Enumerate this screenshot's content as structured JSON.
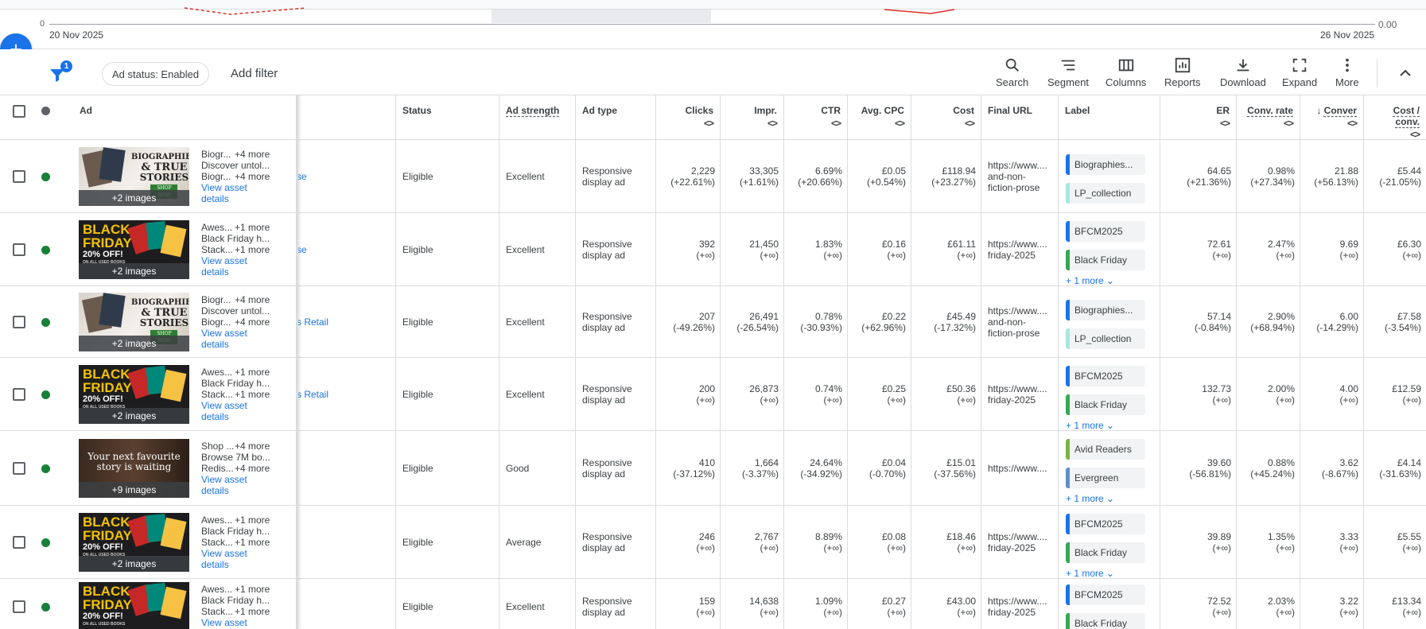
{
  "chart": {
    "axis_left": "0",
    "axis_right": "0.00",
    "date_start": "20 Nov 2025",
    "date_end": "26 Nov 2025"
  },
  "toolbar": {
    "filter_count": "1",
    "status_chip": "Ad status: Enabled",
    "add_filter": "Add filter",
    "tools": [
      "Search",
      "Segment",
      "Columns",
      "Reports",
      "Download",
      "Expand",
      "More"
    ]
  },
  "table": {
    "headers": {
      "ad": "Ad",
      "status": "Status",
      "ad_strength": "Ad strength",
      "ad_type": "Ad type",
      "clicks": "Clicks",
      "impr": "Impr.",
      "ctr": "CTR",
      "avg_cpc": "Avg. CPC",
      "cost": "Cost",
      "final_url": "Final URL",
      "label": "Label",
      "er": "ER",
      "conv_rate": "Conv. rate",
      "conversions": "Conver",
      "cost_conv": "Cost / conv."
    },
    "sort_glyph": "<>",
    "rows": [
      {
        "thumb": "books",
        "images": "+2 images",
        "l1": "Biogr...",
        "l1m": "+4 more",
        "l2": "Discover untol...",
        "l3": "Biogr...",
        "l3m": "+4 more",
        "link1": "View asset",
        "link2": "details",
        "frag": "se",
        "status": "Eligible",
        "strength": "Excellent",
        "type1": "Responsive",
        "type2": "display ad",
        "clicks": "2,229",
        "clicks_c": "(+22.61%)",
        "impr": "33,305",
        "impr_c": "(+1.61%)",
        "ctr": "6.69%",
        "ctr_c": "(+20.66%)",
        "cpc": "£0.05",
        "cpc_c": "(+0.54%)",
        "cost": "£118.94",
        "cost_c": "(+23.27%)",
        "url1": "https://www....",
        "url2": "and-non-",
        "url3": "fiction-prose",
        "labels": [
          {
            "name": "Biographies...",
            "color": "#1a73e8"
          },
          {
            "name": "LP_collection",
            "color": "#a8e6e2"
          }
        ],
        "more": "",
        "er": "64.65",
        "er_c": "(+21.36%)",
        "cr": "0.98%",
        "cr_c": "(+27.34%)",
        "conv": "21.88",
        "conv_c": "(+56.13%)",
        "cpa": "£5.44",
        "cpa_c": "(-21.05%)"
      },
      {
        "thumb": "bf",
        "images": "+2 images",
        "l1": "Awes...",
        "l1m": "+1 more",
        "l2": "Black Friday h...",
        "l3": "Stack...",
        "l3m": "+1 more",
        "link1": "View asset",
        "link2": "details",
        "frag": "se",
        "status": "Eligible",
        "strength": "Excellent",
        "type1": "Responsive",
        "type2": "display ad",
        "clicks": "392",
        "clicks_c": "(+∞)",
        "impr": "21,450",
        "impr_c": "(+∞)",
        "ctr": "1.83%",
        "ctr_c": "(+∞)",
        "cpc": "£0.16",
        "cpc_c": "(+∞)",
        "cost": "£61.11",
        "cost_c": "(+∞)",
        "url1": "https://www....",
        "url2": "friday-2025",
        "url3": "",
        "labels": [
          {
            "name": "BFCM2025",
            "color": "#1a73e8"
          },
          {
            "name": "Black Friday",
            "color": "#34a853"
          }
        ],
        "more": "+ 1 more",
        "er": "72.61",
        "er_c": "(+∞)",
        "cr": "2.47%",
        "cr_c": "(+∞)",
        "conv": "9.69",
        "conv_c": "(+∞)",
        "cpa": "£6.30",
        "cpa_c": "(+∞)"
      },
      {
        "thumb": "books",
        "images": "+2 images",
        "l1": "Biogr...",
        "l1m": "+4 more",
        "l2": "Discover untol...",
        "l3": "Biogr...",
        "l3m": "+4 more",
        "link1": "View asset",
        "link2": "details",
        "frag": "s Retail",
        "status": "Eligible",
        "strength": "Excellent",
        "type1": "Responsive",
        "type2": "display ad",
        "clicks": "207",
        "clicks_c": "(-49.26%)",
        "impr": "26,491",
        "impr_c": "(-26.54%)",
        "ctr": "0.78%",
        "ctr_c": "(-30.93%)",
        "cpc": "£0.22",
        "cpc_c": "(+62.96%)",
        "cost": "£45.49",
        "cost_c": "(-17.32%)",
        "url1": "https://www....",
        "url2": "and-non-",
        "url3": "fiction-prose",
        "labels": [
          {
            "name": "Biographies...",
            "color": "#1a73e8"
          },
          {
            "name": "LP_collection",
            "color": "#a8e6e2"
          }
        ],
        "more": "",
        "er": "57.14",
        "er_c": "(-0.84%)",
        "cr": "2.90%",
        "cr_c": "(+68.94%)",
        "conv": "6.00",
        "conv_c": "(-14.29%)",
        "cpa": "£7.58",
        "cpa_c": "(-3.54%)"
      },
      {
        "thumb": "bf",
        "images": "+2 images",
        "l1": "Awes...",
        "l1m": "+1 more",
        "l2": "Black Friday h...",
        "l3": "Stack...",
        "l3m": "+1 more",
        "link1": "View asset",
        "link2": "details",
        "frag": "s Retail",
        "status": "Eligible",
        "strength": "Excellent",
        "type1": "Responsive",
        "type2": "display ad",
        "clicks": "200",
        "clicks_c": "(+∞)",
        "impr": "26,873",
        "impr_c": "(+∞)",
        "ctr": "0.74%",
        "ctr_c": "(+∞)",
        "cpc": "£0.25",
        "cpc_c": "(+∞)",
        "cost": "£50.36",
        "cost_c": "(+∞)",
        "url1": "https://www....",
        "url2": "friday-2025",
        "url3": "",
        "labels": [
          {
            "name": "BFCM2025",
            "color": "#1a73e8"
          },
          {
            "name": "Black Friday",
            "color": "#34a853"
          }
        ],
        "more": "+ 1 more",
        "er": "132.73",
        "er_c": "(+∞)",
        "cr": "2.00%",
        "cr_c": "(+∞)",
        "conv": "4.00",
        "conv_c": "(+∞)",
        "cpa": "£12.59",
        "cpa_c": "(+∞)"
      },
      {
        "thumb": "dark",
        "thumb_text1": "Your next favourite",
        "thumb_text2": "story is waiting",
        "images": "+9 images",
        "l1": "Shop ...",
        "l1m": "+4 more",
        "l2": "Browse 7M bo...",
        "l3": "Redis...",
        "l3m": "+4 more",
        "link1": "View asset",
        "link2": "details",
        "frag": "",
        "status": "Eligible",
        "strength": "Good",
        "type1": "Responsive",
        "type2": "display ad",
        "clicks": "410",
        "clicks_c": "(-37.12%)",
        "impr": "1,664",
        "impr_c": "(-3.37%)",
        "ctr": "24.64%",
        "ctr_c": "(-34.92%)",
        "cpc": "£0.04",
        "cpc_c": "(-0.70%)",
        "cost": "£15.01",
        "cost_c": "(-37.56%)",
        "url1": "https://www....",
        "url2": "",
        "url3": "",
        "labels": [
          {
            "name": "Avid Readers",
            "color": "#7cb342"
          },
          {
            "name": "Evergreen",
            "color": "#5f8ec8"
          }
        ],
        "more": "+ 1 more",
        "er": "39.60",
        "er_c": "(-56.81%)",
        "cr": "0.88%",
        "cr_c": "(+45.24%)",
        "conv": "3.62",
        "conv_c": "(-8.67%)",
        "cpa": "£4.14",
        "cpa_c": "(-31.63%)"
      },
      {
        "thumb": "bf",
        "images": "+2 images",
        "l1": "Awes...",
        "l1m": "+1 more",
        "l2": "Black Friday h...",
        "l3": "Stack...",
        "l3m": "+1 more",
        "link1": "View asset",
        "link2": "details",
        "frag": "",
        "status": "Eligible",
        "strength": "Average",
        "type1": "Responsive",
        "type2": "display ad",
        "clicks": "246",
        "clicks_c": "(+∞)",
        "impr": "2,767",
        "impr_c": "(+∞)",
        "ctr": "8.89%",
        "ctr_c": "(+∞)",
        "cpc": "£0.08",
        "cpc_c": "(+∞)",
        "cost": "£18.46",
        "cost_c": "(+∞)",
        "url1": "https://www....",
        "url2": "friday-2025",
        "url3": "",
        "labels": [
          {
            "name": "BFCM2025",
            "color": "#1a73e8"
          },
          {
            "name": "Black Friday",
            "color": "#34a853"
          }
        ],
        "more": "+ 1 more",
        "er": "39.89",
        "er_c": "(+∞)",
        "cr": "1.35%",
        "cr_c": "(+∞)",
        "conv": "3.33",
        "conv_c": "(+∞)",
        "cpa": "£5.55",
        "cpa_c": "(+∞)"
      },
      {
        "thumb": "bf",
        "images": "",
        "l1": "Awes...",
        "l1m": "+1 more",
        "l2": "Black Friday h...",
        "l3": "Stack...",
        "l3m": "+1 more",
        "link1": "View asset",
        "link2": "",
        "frag": "",
        "status": "Eligible",
        "strength": "Excellent",
        "type1": "Responsive",
        "type2": "display ad",
        "clicks": "159",
        "clicks_c": "(+∞)",
        "impr": "14,638",
        "impr_c": "(+∞)",
        "ctr": "1.09%",
        "ctr_c": "(+∞)",
        "cpc": "£0.27",
        "cpc_c": "(+∞)",
        "cost": "£43.00",
        "cost_c": "(+∞)",
        "url1": "https://www....",
        "url2": "friday-2025",
        "url3": "",
        "labels": [
          {
            "name": "BFCM2025",
            "color": "#1a73e8"
          },
          {
            "name": "Black Friday",
            "color": "#34a853"
          }
        ],
        "more": "",
        "er": "72.52",
        "er_c": "(+∞)",
        "cr": "2.03%",
        "cr_c": "(+∞)",
        "conv": "3.22",
        "conv_c": "(+∞)",
        "cpa": "£13.34",
        "cpa_c": "(+∞)"
      }
    ]
  },
  "thumb_art": {
    "books_text1": "BIOGRAPHIES",
    "books_text2": "& TRUE",
    "books_text3": "STORIES",
    "books_btn": "SHOP NOW",
    "bf_text1": "BLACK",
    "bf_text2": "FRIDAY",
    "bf_text3": "20% OFF!",
    "bf_text4": "ON ALL USED BOOKS"
  },
  "colors": {
    "accent": "#1a73e8",
    "status_green": "#188038"
  }
}
